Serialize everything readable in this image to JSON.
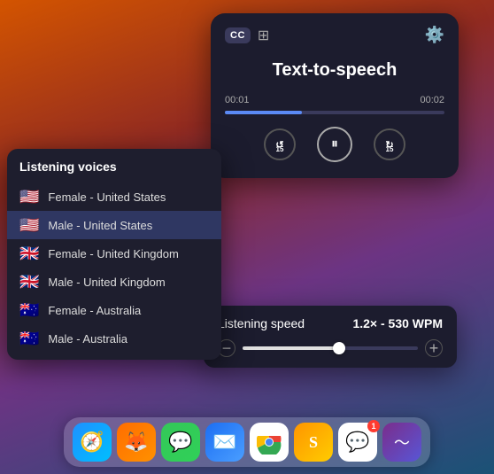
{
  "desktop": {
    "bg_color": "#8e2de2"
  },
  "tts_panel": {
    "title": "Text-to-speech",
    "time_current": "00:01",
    "time_total": "00:02",
    "progress_percent": 35,
    "cc_label": "CC",
    "rewind_label": "15",
    "forward_label": "15"
  },
  "voices_panel": {
    "title": "Listening voices",
    "items": [
      {
        "flag": "🇺🇸",
        "label": "Female - United States",
        "selected": false
      },
      {
        "flag": "🇺🇸",
        "label": "Male - United States",
        "selected": true
      },
      {
        "flag": "🇬🇧",
        "label": "Female - United Kingdom",
        "selected": false
      },
      {
        "flag": "🇬🇧",
        "label": "Male - United Kingdom",
        "selected": false
      },
      {
        "flag": "🇦🇺",
        "label": "Female - Australia",
        "selected": false
      },
      {
        "flag": "🇦🇺",
        "label": "Male - Australia",
        "selected": false
      }
    ]
  },
  "speed_panel": {
    "label": "Listening speed",
    "value": "1.2× - 530 WPM",
    "slider_percent": 55
  },
  "dock": {
    "items": [
      {
        "name": "safari",
        "emoji": "🧭",
        "css_class": "dock-safari",
        "badge": null
      },
      {
        "name": "firefox",
        "emoji": "🦊",
        "css_class": "dock-firefox",
        "badge": null
      },
      {
        "name": "messages",
        "emoji": "💬",
        "css_class": "dock-messages",
        "badge": null
      },
      {
        "name": "mail",
        "emoji": "✉️",
        "css_class": "dock-mail",
        "badge": null
      },
      {
        "name": "chrome",
        "emoji": "🌐",
        "css_class": "dock-chrome",
        "badge": null
      },
      {
        "name": "sublime",
        "emoji": "S",
        "css_class": "dock-sublime",
        "badge": null
      },
      {
        "name": "slack",
        "emoji": "#",
        "css_class": "dock-slack",
        "badge": "1"
      },
      {
        "name": "waves",
        "emoji": "〜",
        "css_class": "dock-waves",
        "badge": null
      }
    ]
  }
}
